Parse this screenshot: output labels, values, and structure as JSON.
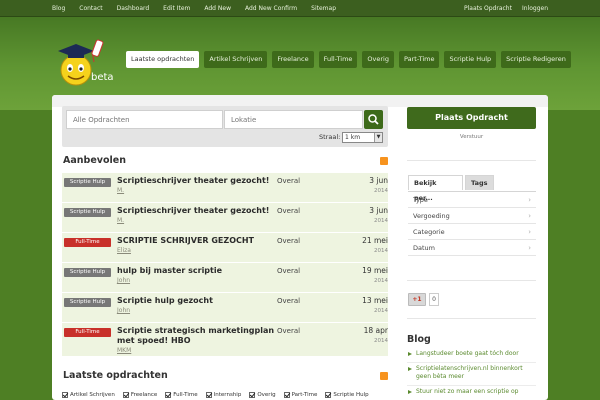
{
  "topnav": {
    "left": [
      "Blog",
      "Contact",
      "Dashboard",
      "Edit Item",
      "Add New",
      "Add New Confirm",
      "Sitemap"
    ],
    "right": [
      "Plaats Opdracht",
      "Inloggen"
    ]
  },
  "logo": {
    "badge": "beta"
  },
  "categories": [
    {
      "label": "Laatste opdrachten",
      "active": true
    },
    {
      "label": "Artikel Schrijven",
      "active": false
    },
    {
      "label": "Freelance",
      "active": false
    },
    {
      "label": "Full-Time",
      "active": false
    },
    {
      "label": "Overig",
      "active": false
    },
    {
      "label": "Part-Time",
      "active": false
    },
    {
      "label": "Scriptie Hulp",
      "active": false
    },
    {
      "label": "Scriptie Redigeren",
      "active": false
    }
  ],
  "search": {
    "query_placeholder": "Alle Opdrachten",
    "location_placeholder": "Lokatie",
    "radius_label": "Straal:",
    "radius_value": "1 km"
  },
  "recommended": {
    "title": "Aanbevolen",
    "jobs": [
      {
        "badge": "Scriptie Hulp",
        "badge_color": "gray",
        "title": "Scriptieschrijver theater gezocht!",
        "author": "M.",
        "location": "Overal",
        "date": "3 jun",
        "year": "2014"
      },
      {
        "badge": "Scriptie Hulp",
        "badge_color": "gray",
        "title": "Scriptieschrijver theater gezocht!",
        "author": "M.",
        "location": "Overal",
        "date": "3 jun",
        "year": "2014"
      },
      {
        "badge": "Full-Time",
        "badge_color": "red",
        "title": "SCRIPTIE SCHRIJVER GEZOCHT",
        "author": "Eliza",
        "location": "Overal",
        "date": "21 mei",
        "year": "2014"
      },
      {
        "badge": "Scriptie Hulp",
        "badge_color": "gray",
        "title": "hulp bij master scriptie",
        "author": "John",
        "location": "Overal",
        "date": "19 mei",
        "year": "2014"
      },
      {
        "badge": "Scriptie Hulp",
        "badge_color": "gray",
        "title": "Scriptie hulp gezocht",
        "author": "John",
        "location": "Overal",
        "date": "13 mei",
        "year": "2014"
      },
      {
        "badge": "Full-Time",
        "badge_color": "red",
        "title": "Scriptie strategisch marketingplan met spoed! HBO",
        "author": "MKM",
        "location": "Overal",
        "date": "18 apr",
        "year": "2014"
      }
    ]
  },
  "latest": {
    "title": "Laatste opdrachten",
    "filters": [
      "Artikel Schrijven",
      "Freelance",
      "Full-Time",
      "Internship",
      "Overig",
      "Part-Time",
      "Scriptie Hulp"
    ]
  },
  "sidebar": {
    "post_button": "Plaats Opdracht",
    "post_sub": "Verstuur",
    "tabs": [
      "Bekijk per...",
      "Tags"
    ],
    "filter_rows": [
      "Type",
      "Vergoeding",
      "Categorie",
      "Datum"
    ],
    "gplus_label": "+1",
    "gplus_count": "0",
    "blog_title": "Blog",
    "blog_items": [
      "Langstudeer boete gaat tóch door",
      "Scriptielatenschrijven.nl binnenkort geen bèta meer",
      "Stuur niet zo maar een scriptie op"
    ]
  },
  "colors": {
    "brand_green": "#3f6a1c",
    "badge_gray": "#777777",
    "badge_red": "#c8302a",
    "rss_orange": "#f7931e"
  }
}
